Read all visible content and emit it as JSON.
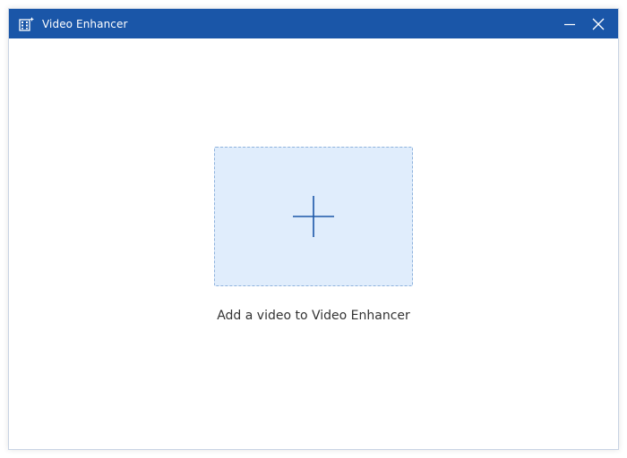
{
  "window": {
    "title": "Video Enhancer",
    "app_icon": "video-enhancer-app-icon",
    "minimize_icon": "minimize-icon",
    "close_icon": "close-icon"
  },
  "main": {
    "add_icon": "plus-icon",
    "hint": "Add a video to Video Enhancer"
  },
  "colors": {
    "titlebar": "#1a56a8",
    "dropzone_fill": "#e0edfc",
    "dropzone_border": "#8fb3dd",
    "plus": "#1a56a8",
    "hint_text": "#333333"
  }
}
